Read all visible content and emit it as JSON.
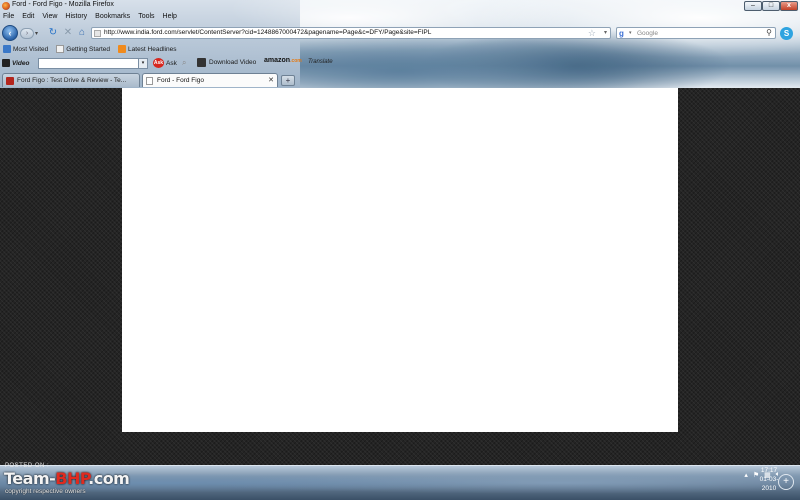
{
  "window": {
    "title": "Ford - Ford Figo - Mozilla Firefox",
    "min_glyph": "–",
    "max_glyph": "□",
    "close_glyph": "x"
  },
  "menu": [
    "File",
    "Edit",
    "View",
    "History",
    "Bookmarks",
    "Tools",
    "Help"
  ],
  "nav": {
    "url": "http://www.india.ford.com/servlet/ContentServer?cid=1248867000472&pagename=Page&c=DFY/Page&site=FIPL",
    "search_placeholder": "Google"
  },
  "bookmarks": [
    "Most Visited",
    "Getting Started",
    "Latest Headlines"
  ],
  "toolbar2": {
    "video_label": "Video",
    "ask_label": "Ask",
    "download_label": "Download Video",
    "amazon_label": "amazon",
    "amazon_tld": ".com",
    "translate_label": "Translate"
  },
  "tabs": [
    {
      "label": "Ford Figo : Test Drive & Review - Te...",
      "active": false
    },
    {
      "label": "Ford - Ford Figo",
      "active": true
    }
  ],
  "watermark": {
    "posted_on": "POSTED ON :",
    "brand_a": "Team-",
    "brand_b": "BHP",
    "brand_c": ".com",
    "copyright": "copyright respective owners"
  },
  "clock": {
    "time": "17:17",
    "date": "01-03-2010"
  },
  "colors": {
    "page_bg": "#ffffff",
    "content_bg": "#242424",
    "brand_red": "#e02b20"
  }
}
